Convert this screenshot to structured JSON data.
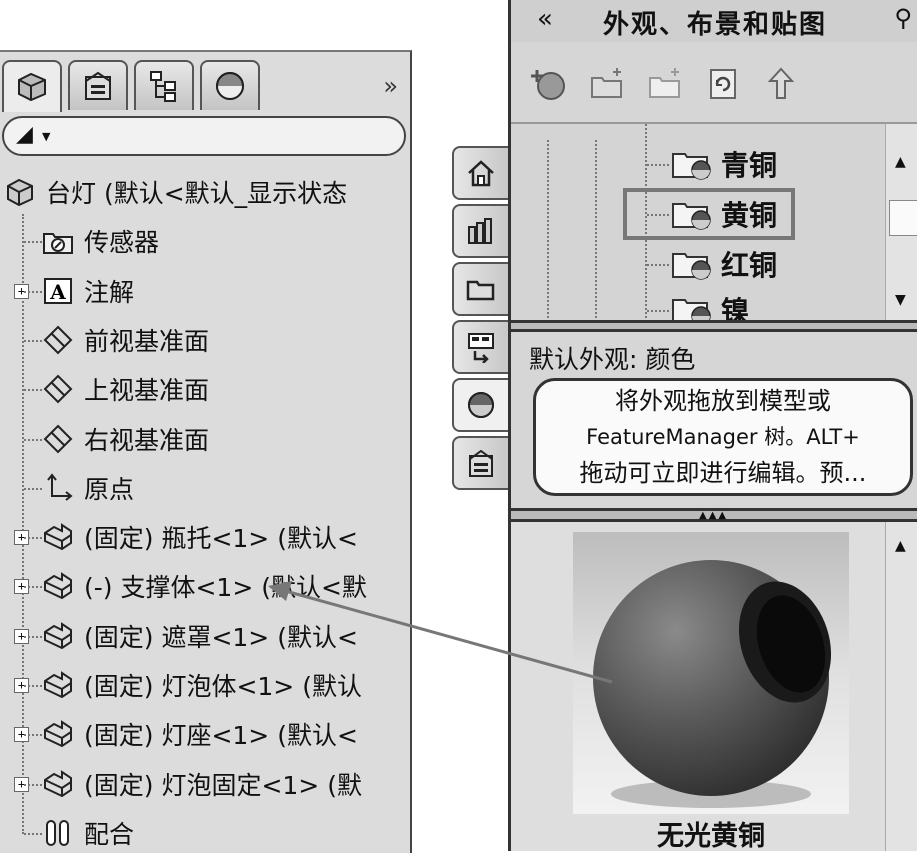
{
  "left_panel": {
    "expand_label": "»",
    "tree": {
      "root": "台灯  (默认<默认_显示状态",
      "items": [
        {
          "label": "传感器",
          "icon": "sensor-folder-icon",
          "expandable": false
        },
        {
          "label": "注解",
          "icon": "annotation-icon",
          "expandable": true
        },
        {
          "label": "前视基准面",
          "icon": "plane-icon",
          "expandable": false
        },
        {
          "label": "上视基准面",
          "icon": "plane-icon",
          "expandable": false
        },
        {
          "label": "右视基准面",
          "icon": "plane-icon",
          "expandable": false
        },
        {
          "label": "原点",
          "icon": "origin-icon",
          "expandable": false
        },
        {
          "label": "(固定) 瓶托<1> (默认<",
          "icon": "part-icon",
          "expandable": true
        },
        {
          "label": "(-) 支撑体<1> (默认<默",
          "icon": "part-icon",
          "expandable": true
        },
        {
          "label": "(固定) 遮罩<1> (默认<",
          "icon": "part-icon",
          "expandable": true
        },
        {
          "label": "(固定) 灯泡体<1> (默认",
          "icon": "part-icon",
          "expandable": true
        },
        {
          "label": "(固定) 灯座<1> (默认<",
          "icon": "part-icon",
          "expandable": true
        },
        {
          "label": "(固定) 灯泡固定<1> (默",
          "icon": "part-icon",
          "expandable": true
        },
        {
          "label": "配合",
          "icon": "mates-icon",
          "expandable": false
        }
      ]
    }
  },
  "right_pane": {
    "collapse_label": "«",
    "title": "外观、布景和贴图",
    "folders": [
      "青铜",
      "黄铜",
      "红铜",
      "镍"
    ],
    "selected_folder": "黄铜",
    "appearance_label": "默认外观: 颜色",
    "tooltip": {
      "line1": "将外观拖放到模型或",
      "line2": "FeatureManager 树。ALT+",
      "line3": "拖动可立即进行编辑。预..."
    },
    "preview_caption": "无光黄铜"
  }
}
